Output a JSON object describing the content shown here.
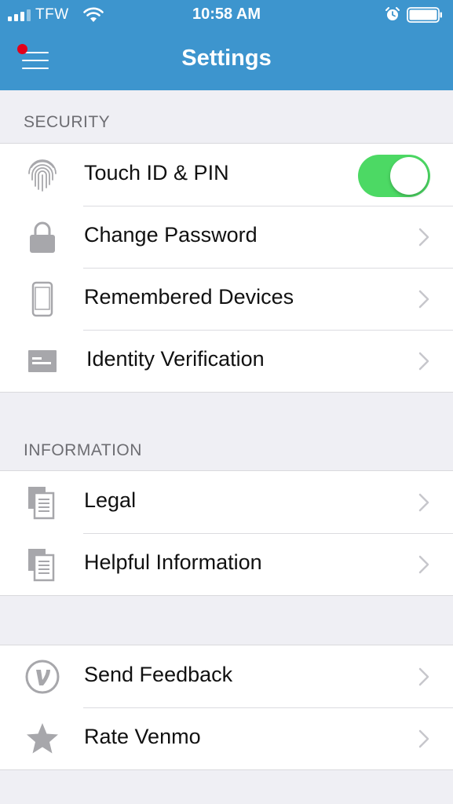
{
  "status_bar": {
    "carrier": "TFW",
    "time": "10:58 AM"
  },
  "header": {
    "title": "Settings"
  },
  "sections": {
    "security": {
      "title": "SECURITY",
      "items": [
        {
          "label": "Touch ID & PIN",
          "icon": "fingerprint-icon",
          "toggle_on": true
        },
        {
          "label": "Change Password",
          "icon": "lock-icon"
        },
        {
          "label": "Remembered Devices",
          "icon": "phone-icon"
        },
        {
          "label": "Identity Verification",
          "icon": "id-card-icon"
        }
      ]
    },
    "information": {
      "title": "INFORMATION",
      "items": [
        {
          "label": "Legal",
          "icon": "documents-icon"
        },
        {
          "label": "Helpful Information",
          "icon": "documents-icon"
        }
      ]
    },
    "other": {
      "items": [
        {
          "label": "Send Feedback",
          "icon": "venmo-logo-icon"
        },
        {
          "label": "Rate Venmo",
          "icon": "star-icon"
        }
      ]
    }
  },
  "colors": {
    "header_bg": "#3d95ce",
    "toggle_on": "#4cd964",
    "notification_dot": "#e2001a",
    "icon_gray": "#a7a7ab"
  }
}
